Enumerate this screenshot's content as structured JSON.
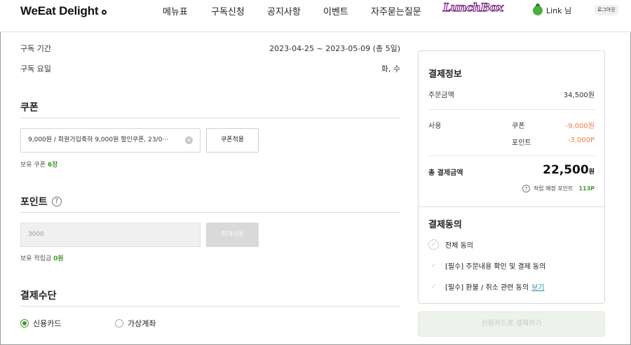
{
  "header": {
    "logo": "WeEat Delight",
    "nav": [
      "메뉴표",
      "구독신청",
      "공지사항",
      "이벤트",
      "자주묻는질문"
    ],
    "lunchbox": "LunchBox",
    "user": "Link 님",
    "logout": "로그아웃"
  },
  "subscription": {
    "period_label": "구독 기간",
    "period_value": "2023-04-25 ~ 2023-05-09 (총 5일)",
    "days_label": "구독 요일",
    "days_value": "화, 수"
  },
  "coupon": {
    "title": "쿠폰",
    "selected": "9,000원 / 회원가입축하 9,000원 할인쿠폰, 23/0···",
    "apply_button": "쿠폰적용",
    "owned_label": "보유 쿠폰",
    "owned_count": "6장"
  },
  "point": {
    "title": "포인트",
    "input_value": "3000",
    "max_button": "최대사용",
    "owned_label": "보유 적립금",
    "owned_amount": "0원"
  },
  "payment_method": {
    "title": "결제수단",
    "options": [
      "신용카드",
      "가상계좌"
    ],
    "selected": "신용카드"
  },
  "payment_info": {
    "title": "결제정보",
    "order_label": "주문금액",
    "order_amount": "34,500원",
    "use_label": "사용",
    "coupon_label": "쿠폰",
    "coupon_amount": "-9,000원",
    "point_label": "포인트",
    "point_amount": "-3,000P",
    "total_label": "총 결제금액",
    "total_amount": "22,500",
    "total_unit": "원",
    "accrue_label": "적립 예정 포인트",
    "accrue_amount": "113P"
  },
  "agreement": {
    "title": "결제동의",
    "all": "전체 동의",
    "item1": "[필수] 주문내용 확인 및 결제 동의",
    "item2": "[필수] 환불 / 취소 관련 동의",
    "view_link": "보기"
  },
  "pay_button": "신용카드로 결제하기"
}
